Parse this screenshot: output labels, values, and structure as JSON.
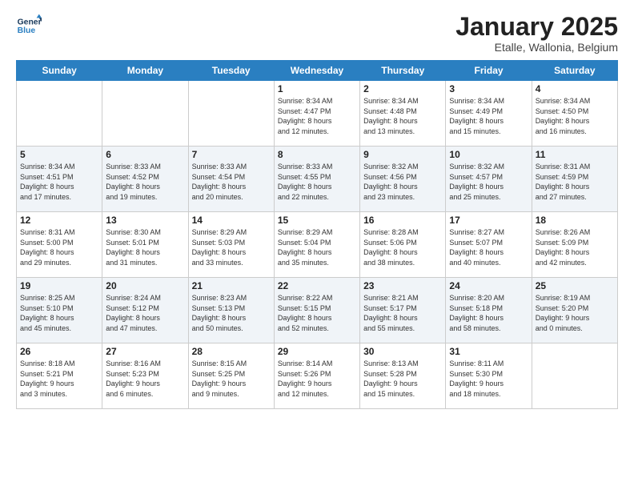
{
  "app": {
    "logo_line1": "General",
    "logo_line2": "Blue"
  },
  "title": "January 2025",
  "subtitle": "Etalle, Wallonia, Belgium",
  "weekdays": [
    "Sunday",
    "Monday",
    "Tuesday",
    "Wednesday",
    "Thursday",
    "Friday",
    "Saturday"
  ],
  "weeks": [
    [
      {
        "date": "",
        "info": ""
      },
      {
        "date": "",
        "info": ""
      },
      {
        "date": "",
        "info": ""
      },
      {
        "date": "1",
        "info": "Sunrise: 8:34 AM\nSunset: 4:47 PM\nDaylight: 8 hours\nand 12 minutes."
      },
      {
        "date": "2",
        "info": "Sunrise: 8:34 AM\nSunset: 4:48 PM\nDaylight: 8 hours\nand 13 minutes."
      },
      {
        "date": "3",
        "info": "Sunrise: 8:34 AM\nSunset: 4:49 PM\nDaylight: 8 hours\nand 15 minutes."
      },
      {
        "date": "4",
        "info": "Sunrise: 8:34 AM\nSunset: 4:50 PM\nDaylight: 8 hours\nand 16 minutes."
      }
    ],
    [
      {
        "date": "5",
        "info": "Sunrise: 8:34 AM\nSunset: 4:51 PM\nDaylight: 8 hours\nand 17 minutes."
      },
      {
        "date": "6",
        "info": "Sunrise: 8:33 AM\nSunset: 4:52 PM\nDaylight: 8 hours\nand 19 minutes."
      },
      {
        "date": "7",
        "info": "Sunrise: 8:33 AM\nSunset: 4:54 PM\nDaylight: 8 hours\nand 20 minutes."
      },
      {
        "date": "8",
        "info": "Sunrise: 8:33 AM\nSunset: 4:55 PM\nDaylight: 8 hours\nand 22 minutes."
      },
      {
        "date": "9",
        "info": "Sunrise: 8:32 AM\nSunset: 4:56 PM\nDaylight: 8 hours\nand 23 minutes."
      },
      {
        "date": "10",
        "info": "Sunrise: 8:32 AM\nSunset: 4:57 PM\nDaylight: 8 hours\nand 25 minutes."
      },
      {
        "date": "11",
        "info": "Sunrise: 8:31 AM\nSunset: 4:59 PM\nDaylight: 8 hours\nand 27 minutes."
      }
    ],
    [
      {
        "date": "12",
        "info": "Sunrise: 8:31 AM\nSunset: 5:00 PM\nDaylight: 8 hours\nand 29 minutes."
      },
      {
        "date": "13",
        "info": "Sunrise: 8:30 AM\nSunset: 5:01 PM\nDaylight: 8 hours\nand 31 minutes."
      },
      {
        "date": "14",
        "info": "Sunrise: 8:29 AM\nSunset: 5:03 PM\nDaylight: 8 hours\nand 33 minutes."
      },
      {
        "date": "15",
        "info": "Sunrise: 8:29 AM\nSunset: 5:04 PM\nDaylight: 8 hours\nand 35 minutes."
      },
      {
        "date": "16",
        "info": "Sunrise: 8:28 AM\nSunset: 5:06 PM\nDaylight: 8 hours\nand 38 minutes."
      },
      {
        "date": "17",
        "info": "Sunrise: 8:27 AM\nSunset: 5:07 PM\nDaylight: 8 hours\nand 40 minutes."
      },
      {
        "date": "18",
        "info": "Sunrise: 8:26 AM\nSunset: 5:09 PM\nDaylight: 8 hours\nand 42 minutes."
      }
    ],
    [
      {
        "date": "19",
        "info": "Sunrise: 8:25 AM\nSunset: 5:10 PM\nDaylight: 8 hours\nand 45 minutes."
      },
      {
        "date": "20",
        "info": "Sunrise: 8:24 AM\nSunset: 5:12 PM\nDaylight: 8 hours\nand 47 minutes."
      },
      {
        "date": "21",
        "info": "Sunrise: 8:23 AM\nSunset: 5:13 PM\nDaylight: 8 hours\nand 50 minutes."
      },
      {
        "date": "22",
        "info": "Sunrise: 8:22 AM\nSunset: 5:15 PM\nDaylight: 8 hours\nand 52 minutes."
      },
      {
        "date": "23",
        "info": "Sunrise: 8:21 AM\nSunset: 5:17 PM\nDaylight: 8 hours\nand 55 minutes."
      },
      {
        "date": "24",
        "info": "Sunrise: 8:20 AM\nSunset: 5:18 PM\nDaylight: 8 hours\nand 58 minutes."
      },
      {
        "date": "25",
        "info": "Sunrise: 8:19 AM\nSunset: 5:20 PM\nDaylight: 9 hours\nand 0 minutes."
      }
    ],
    [
      {
        "date": "26",
        "info": "Sunrise: 8:18 AM\nSunset: 5:21 PM\nDaylight: 9 hours\nand 3 minutes."
      },
      {
        "date": "27",
        "info": "Sunrise: 8:16 AM\nSunset: 5:23 PM\nDaylight: 9 hours\nand 6 minutes."
      },
      {
        "date": "28",
        "info": "Sunrise: 8:15 AM\nSunset: 5:25 PM\nDaylight: 9 hours\nand 9 minutes."
      },
      {
        "date": "29",
        "info": "Sunrise: 8:14 AM\nSunset: 5:26 PM\nDaylight: 9 hours\nand 12 minutes."
      },
      {
        "date": "30",
        "info": "Sunrise: 8:13 AM\nSunset: 5:28 PM\nDaylight: 9 hours\nand 15 minutes."
      },
      {
        "date": "31",
        "info": "Sunrise: 8:11 AM\nSunset: 5:30 PM\nDaylight: 9 hours\nand 18 minutes."
      },
      {
        "date": "",
        "info": ""
      }
    ]
  ]
}
